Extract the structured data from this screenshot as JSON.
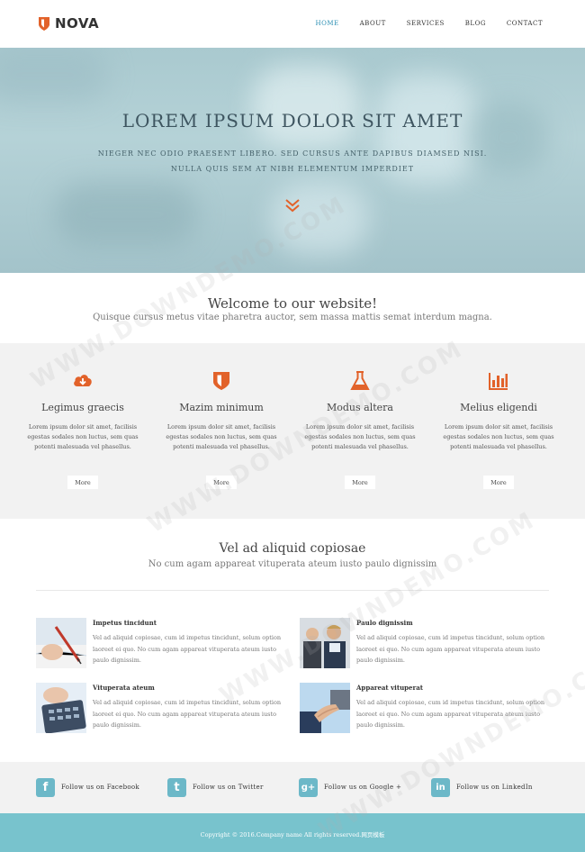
{
  "nav": {
    "logo_text": "NOVA",
    "items": [
      {
        "label": "HOME",
        "active": true
      },
      {
        "label": "ABOUT",
        "active": false
      },
      {
        "label": "SERVICES",
        "active": false
      },
      {
        "label": "BLOG",
        "active": false
      },
      {
        "label": "CONTACT",
        "active": false
      }
    ]
  },
  "hero": {
    "title": "LOREM IPSUM DOLOR SIT AMET",
    "subtitle_line1": "NIEGER NEC ODIO PRAESENT LIBERO. SED CURSUS ANTE DAPIBUS DIAMSED NISI.",
    "subtitle_line2": "NULLA QUIS SEM AT NIBH ELEMENTUM IMPERDIET"
  },
  "welcome": {
    "title": "Welcome to our website!",
    "subtitle": "Quisque cursus metus vitae pharetra auctor, sem massa mattis semat interdum magna."
  },
  "features": [
    {
      "icon": "cloud-download-icon",
      "title": "Legimus graecis",
      "text": "Lorem ipsum dolor sit amet, facilisis egestas sodales non luctus, sem quas potenti malesuada vel phasellus.",
      "button": "More"
    },
    {
      "icon": "shield-icon",
      "title": "Mazim minimum",
      "text": "Lorem ipsum dolor sit amet, facilisis egestas sodales non luctus, sem quas potenti malesuada vel phasellus.",
      "button": "More"
    },
    {
      "icon": "flask-icon",
      "title": "Modus altera",
      "text": "Lorem ipsum dolor sit amet, facilisis egestas sodales non luctus, sem quas potenti malesuada vel phasellus.",
      "button": "More"
    },
    {
      "icon": "bar-chart-icon",
      "title": "Melius eligendi",
      "text": "Lorem ipsum dolor sit amet, facilisis egestas sodales non luctus, sem quas potenti malesuada vel phasellus.",
      "button": "More"
    }
  ],
  "section2": {
    "title": "Vel ad aliquid copiosae",
    "subtitle": "No cum agam appareat vituperata ateum iusto paulo dignissim"
  },
  "items": [
    {
      "title": "Impetus tincidunt",
      "text": "Vel ad aliquid copiosae, cum id impetus tincidunt, solum option laoreet ei quo. No cum agam appareat vituperata ateum iusto paulo dignissim."
    },
    {
      "title": "Paulo dignissim",
      "text": "Vel ad aliquid copiosae, cum id impetus tincidunt, solum option laoreet ei quo. No cum agam appareat vituperata ateum iusto paulo dignissim."
    },
    {
      "title": "Vituperata ateum",
      "text": "Vel ad aliquid copiosae, cum id impetus tincidunt, solum option laoreet ei quo. No cum agam appareat vituperata ateum iusto paulo dignissim."
    },
    {
      "title": "Appareat vituperat",
      "text": "Vel ad aliquid copiosae, cum id impetus tincidunt, solum option laoreet ei quo. No cum agam appareat vituperata ateum iusto paulo dignissim."
    }
  ],
  "social": [
    {
      "icon": "facebook-icon",
      "glyph": "f",
      "label": "Follow us on Facebook"
    },
    {
      "icon": "twitter-icon",
      "glyph": "t",
      "label": "Follow us on Twitter"
    },
    {
      "icon": "google-plus-icon",
      "glyph": "g+",
      "label": "Follow us on Google +"
    },
    {
      "icon": "linkedin-icon",
      "glyph": "in",
      "label": "Follow us on LinkedIn"
    }
  ],
  "footer": {
    "copyright": "Copyright © 2016.Company name All rights reserved.网页模板"
  },
  "watermark": "WWW.DOWNDEMO.COM",
  "colors": {
    "accent_orange": "#e2622a",
    "nav_active": "#2a8fb3",
    "footer_teal": "#78c3cd",
    "social_icon": "#6cb8c8"
  }
}
